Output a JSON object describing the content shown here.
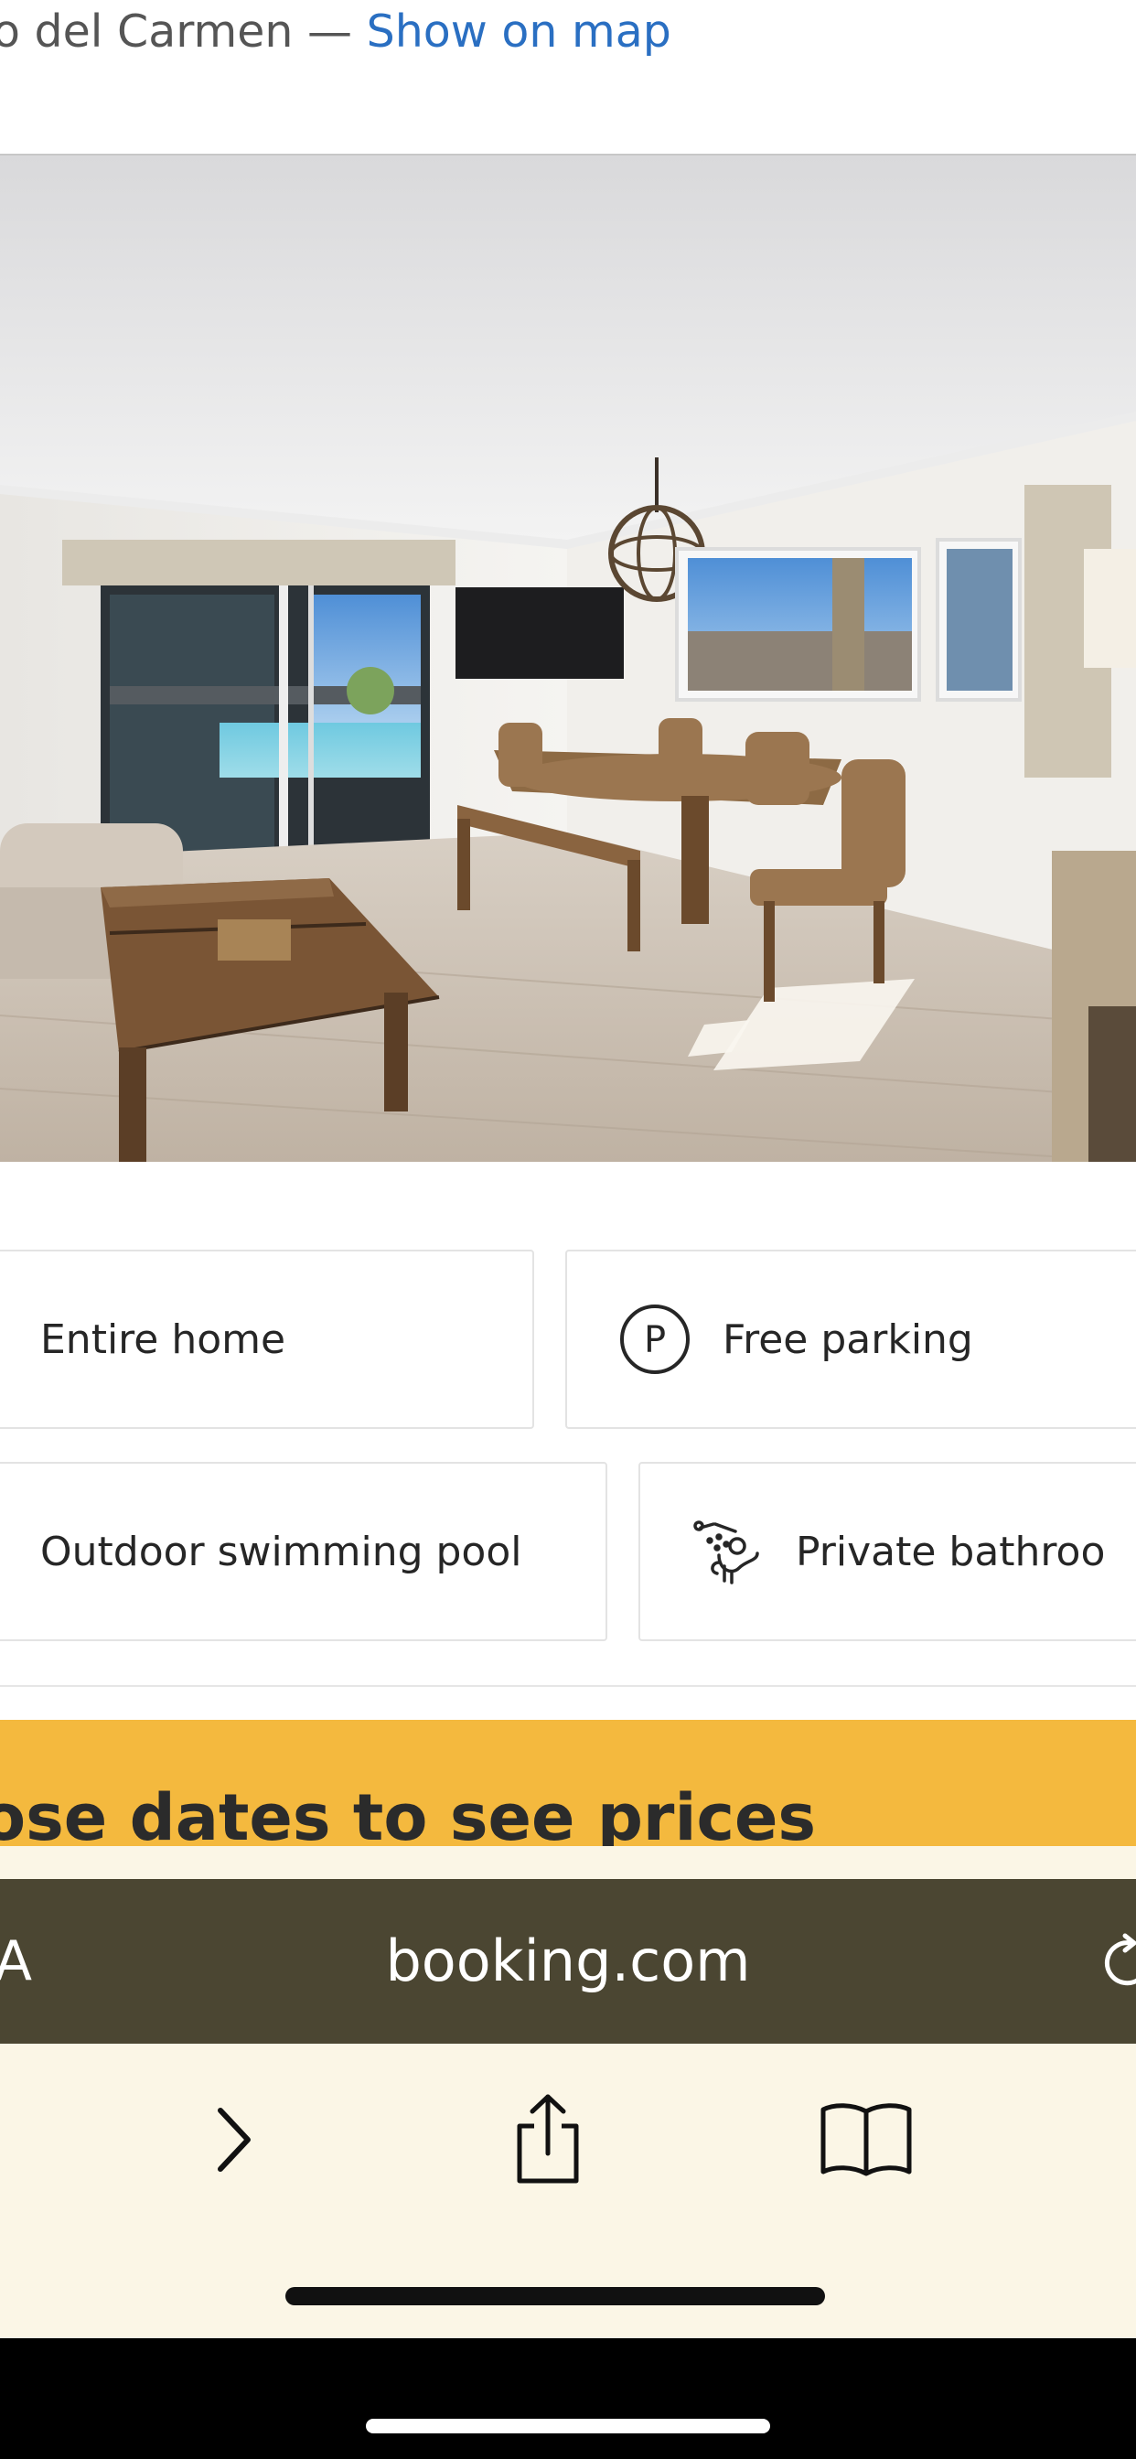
{
  "address": {
    "text": "o del Carmen — ",
    "link_label": "Show on map"
  },
  "photo": {
    "alt_icon": "living-room-photo"
  },
  "facilities": {
    "items": [
      {
        "label": "Entire home",
        "icon": "none"
      },
      {
        "label": "Free parking",
        "icon": "parking-icon"
      },
      {
        "label": "Outdoor swimming pool",
        "icon": "none"
      },
      {
        "label": "Private bathroo",
        "icon": "shower-icon"
      }
    ]
  },
  "banner": {
    "text": "ose dates to see prices",
    "color": "#f4b93e"
  },
  "browser": {
    "aa_label": "A",
    "domain": "booking.com",
    "bar_color": "#4b4632",
    "toolbar_color": "#fbf6e6"
  }
}
